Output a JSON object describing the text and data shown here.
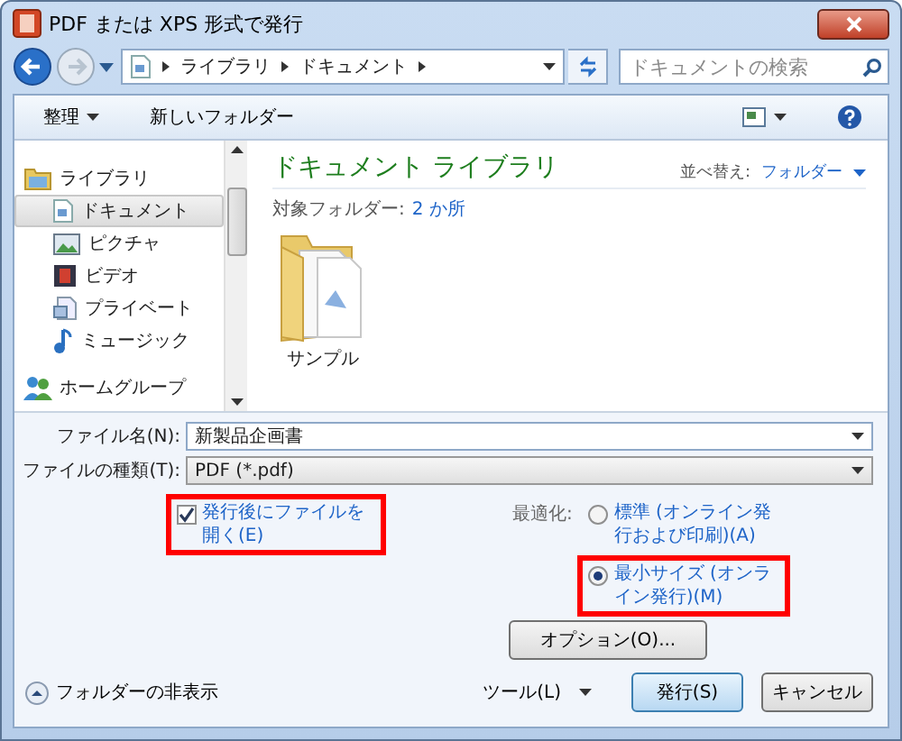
{
  "window": {
    "title": "PDF または XPS 形式で発行"
  },
  "address": {
    "crumbs": [
      "ライブラリ",
      "ドキュメント"
    ]
  },
  "search": {
    "placeholder": "ドキュメントの検索"
  },
  "toolbar": {
    "organize": "整理",
    "new_folder": "新しいフォルダー"
  },
  "sidebar": {
    "items": [
      {
        "label": "ライブラリ",
        "kind": "library",
        "selected": false,
        "children": [
          {
            "label": "ドキュメント",
            "kind": "documents",
            "selected": true
          },
          {
            "label": "ピクチャ",
            "kind": "pictures",
            "selected": false
          },
          {
            "label": "ビデオ",
            "kind": "videos",
            "selected": false
          },
          {
            "label": "プライベート",
            "kind": "private",
            "selected": false
          },
          {
            "label": "ミュージック",
            "kind": "music",
            "selected": false
          }
        ]
      },
      {
        "label": "ホームグループ",
        "kind": "homegroup",
        "selected": false
      }
    ]
  },
  "library": {
    "title": "ドキュメント ライブラリ",
    "scope_label": "対象フォルダー:",
    "scope_link": "2 か所",
    "sort_label": "並べ替え:",
    "sort_value": "フォルダー"
  },
  "files": [
    {
      "name": "サンプル",
      "kind": "folder"
    }
  ],
  "form": {
    "file_name": {
      "label": "ファイル名(N):",
      "value": "新製品企画書"
    },
    "file_type": {
      "label": "ファイルの種類(T):",
      "value": "PDF (*.pdf)"
    },
    "open_after": {
      "label": "発行後にファイルを開く(E)",
      "checked": true,
      "highlighted": true
    },
    "optimize": {
      "label": "最適化:",
      "options": [
        {
          "label": "標準 (オンライン発行および印刷)(A)",
          "selected": false,
          "highlighted": false
        },
        {
          "label": "最小サイズ (オンライン発行)(M)",
          "selected": true,
          "highlighted": true
        }
      ]
    },
    "options_button": "オプション(O)..."
  },
  "footer": {
    "hide_folders": "フォルダーの非表示",
    "tools": "ツール(L)",
    "publish": "発行(S)",
    "cancel": "キャンセル"
  }
}
